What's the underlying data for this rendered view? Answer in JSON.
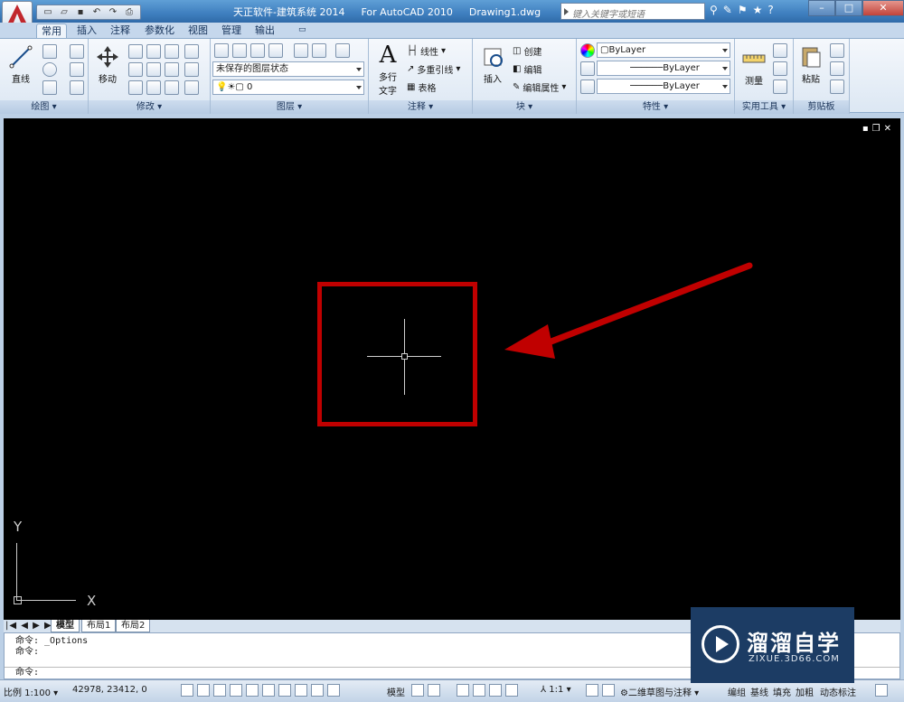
{
  "titlebar": {
    "product": "天正软件-建筑系统 2014",
    "app": "For AutoCAD 2010",
    "file": "Drawing1.dwg",
    "search_placeholder": "键入关键字或短语",
    "qat_icons": [
      "new-icon",
      "open-icon",
      "save-icon",
      "undo-icon",
      "redo-icon",
      "print-icon"
    ]
  },
  "tabs": [
    {
      "label": "常用",
      "active": true
    },
    {
      "label": "插入"
    },
    {
      "label": "注释"
    },
    {
      "label": "参数化"
    },
    {
      "label": "视图"
    },
    {
      "label": "管理"
    },
    {
      "label": "输出"
    }
  ],
  "panels": {
    "draw": {
      "title": "绘图",
      "line": "直线"
    },
    "modify": {
      "title": "修改",
      "move": "移动"
    },
    "layers": {
      "title": "图层",
      "layer_state": "未保存的图层状态",
      "current_layer": "0"
    },
    "annotation": {
      "title": "注释",
      "multiline_text": "多行\n文字",
      "linear": "线性",
      "multileader": "多重引线",
      "table": "表格"
    },
    "block": {
      "title": "块",
      "insert": "插入",
      "create": "创建",
      "edit": "编辑",
      "edit_attributes": "编辑属性"
    },
    "properties": {
      "title": "特性",
      "color": "ByLayer",
      "linetype": "ByLayer",
      "lineweight": "ByLayer"
    },
    "utilities": {
      "title": "实用工具",
      "measure": "测量"
    },
    "clipboard": {
      "title": "剪贴板",
      "paste": "粘贴"
    }
  },
  "canvas": {
    "background": "#000000",
    "highlight_color": "#c00000",
    "ucs_x": "X",
    "ucs_y": "Y"
  },
  "layout_tabs": [
    "模型",
    "布局1",
    "布局2"
  ],
  "command_line": {
    "history": [
      "命令: _Options",
      "命令:"
    ],
    "prompt": "命令:"
  },
  "status": {
    "scale": "比例 1:100",
    "coordinates": "42978, 23412, 0",
    "model": "模型",
    "anno_scale": "1:1",
    "workspace": "二维草图与注释",
    "buttons": [
      "编组",
      "基线",
      "填充",
      "加粗",
      "动态标注"
    ]
  },
  "watermark": {
    "title": "溜溜自学",
    "url": "ZIXUE.3D66.COM"
  }
}
